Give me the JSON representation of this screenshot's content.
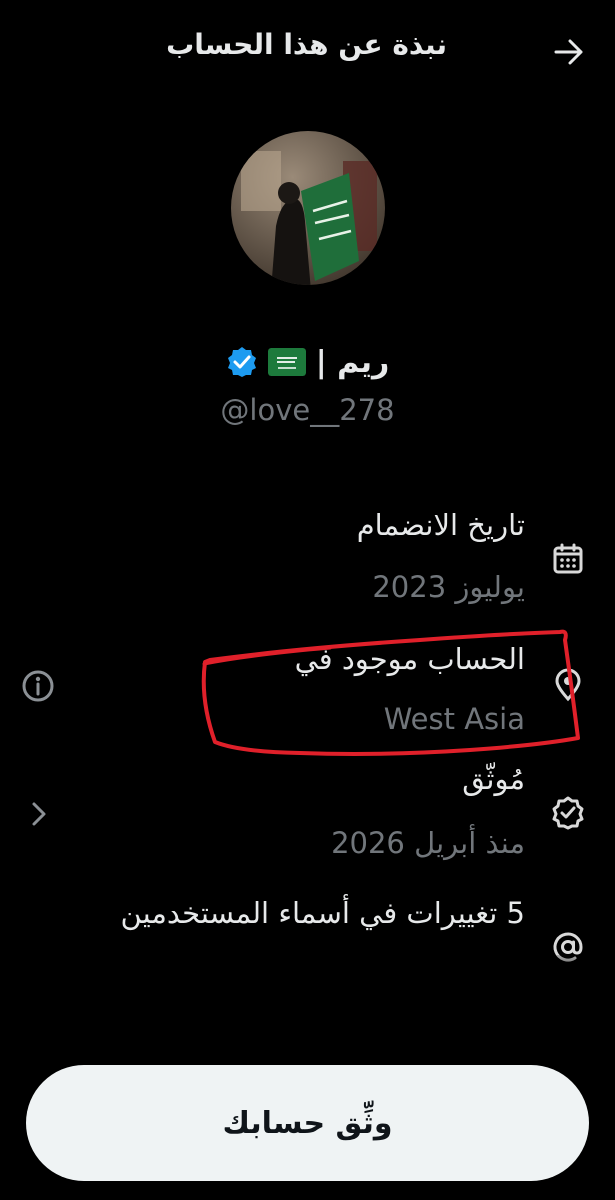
{
  "header": {
    "title": "نبذة عن هذا الحساب",
    "back_icon": "arrow-right-icon"
  },
  "profile": {
    "display_name": "ريم |",
    "flag": "Saudi Arabia flag",
    "verified": true,
    "handle": "@love__278"
  },
  "sections": {
    "joined": {
      "icon": "calendar-icon",
      "title": "تاريخ الانضمام",
      "value": "يوليوز 2023"
    },
    "location": {
      "icon": "location-pin-icon",
      "title": "الحساب موجود في",
      "value": "West Asia",
      "info_icon": "info-icon"
    },
    "verified": {
      "icon": "verified-check-icon",
      "title": "مُوثّق",
      "value": "منذ أبريل 2026",
      "chevron_icon": "chevron-left-icon"
    },
    "username_changes": {
      "icon": "at-sign-icon",
      "title": "5 تغييرات في أسماء المستخدمين"
    }
  },
  "cta": {
    "label": "وثِّق حسابك"
  },
  "colors": {
    "background": "#000000",
    "primary_text": "#e7e9ea",
    "secondary_text": "#71767b",
    "verified_blue": "#1d9bf0",
    "annotation_red": "#e0202a"
  }
}
